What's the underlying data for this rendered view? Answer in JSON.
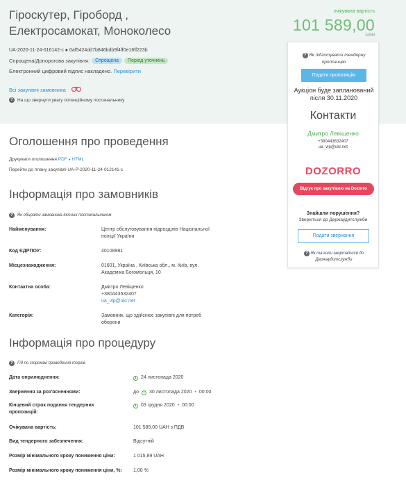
{
  "header": {
    "title_line1": "Гіроскутер, Гіроборд ,",
    "title_line2": "Електросамокат, Моноколесо",
    "tender_id": "UA-2020-11-24-016142-c ● 0af5424dd7b846bdb9f4ff0e16ff223b",
    "procedure_label": "Спрощена/Допорогова закупівля:",
    "procedure_badge": "Спрощена",
    "status_badge": "Період уточнень",
    "signature_text": "Електронний цифровий підпис накладено.",
    "signature_check": "Перевірити",
    "all_procurements_link": "Всі закупівлі замовника",
    "attention_text": "На що звернути увагу потенційному постачальнику"
  },
  "expected_value": {
    "label": "очікувана вартість",
    "amount": "101 589,00",
    "currency": "UAH"
  },
  "sidebar": {
    "how_to_prepare": "Як підготувати тендерну пропозицію",
    "submit_offer_button": "Подати пропозицію",
    "auction_text": "Аукціон буде запланований після 30.11.2020",
    "contacts_title": "Контакти",
    "contact_name": "Дмитро Левіщенко",
    "contact_phone": "+380443632407",
    "contact_email": "ua_vlp@ukr.net",
    "dozorro_logo": "DOZORRO",
    "review_button": "Відгук про закупівлю на Dozorro",
    "violations_title": "Знайшли порушення?",
    "violations_sub": "Зверніться до Держаудитслужби",
    "complaint_button": "Подати звернення",
    "when_to_contact": "Як та коли звертатися до Держаудитслужби"
  },
  "announcement": {
    "title": "Оголошення про проведення",
    "print_label": "Друкувати оголошення",
    "print_pdf": "PDF",
    "print_sep": "●",
    "print_html": "HTML",
    "plan_link": "Перейти до плану закупівлі UA-P-2020-11-24-012141-c"
  },
  "customer": {
    "title": "Інформація про замовників",
    "hint": "Як обирати замовника якісних постачальником",
    "rows": [
      {
        "label": "Найменування:",
        "value": "Центр обслуговування підрозділів Національної поліції України"
      },
      {
        "label": "Код ЄДРПОУ:",
        "value": "40108981"
      },
      {
        "label": "Місцезнаходження:",
        "value": "01601, Україна , Київська обл., м. Київ, вул. Академіка Богомольця, 10"
      },
      {
        "label": "Контактна особа:",
        "value": "Дмитро Левіщенко",
        "phone": "+380443632407",
        "email": "ua_vlp@ukr.net"
      },
      {
        "label": "Категорія:",
        "value": "Замовник, що здійснює закупівлі для потреб оборони"
      }
    ]
  },
  "procedure": {
    "title": "Інформація про процедуру",
    "hint": "Гід по строкам проведення торгів",
    "rows": [
      {
        "label": "Дата оприлюднення:",
        "value": "24 листопада 2020"
      },
      {
        "label": "Звернення за роз'ясненнями:",
        "prefix": "до",
        "value": "30 листопада 2020",
        "time": "00:00"
      },
      {
        "label": "Кінцевий строк подання тендерних пропозицій:",
        "value": "03 грудня 2020",
        "time": "00:00"
      },
      {
        "label": "Очікувана вартість:",
        "value": "101 589,00 UAH з ПДВ"
      },
      {
        "label": "Вид тендерного забезпечення:",
        "value": "Відсутній"
      },
      {
        "label": "Розмір мінімального кроку пониження ціни:",
        "value": "1 015,89 UAH"
      },
      {
        "label": "Розмір мінімального кроку пониження ціни, %:",
        "value": "1,00 %"
      }
    ]
  }
}
